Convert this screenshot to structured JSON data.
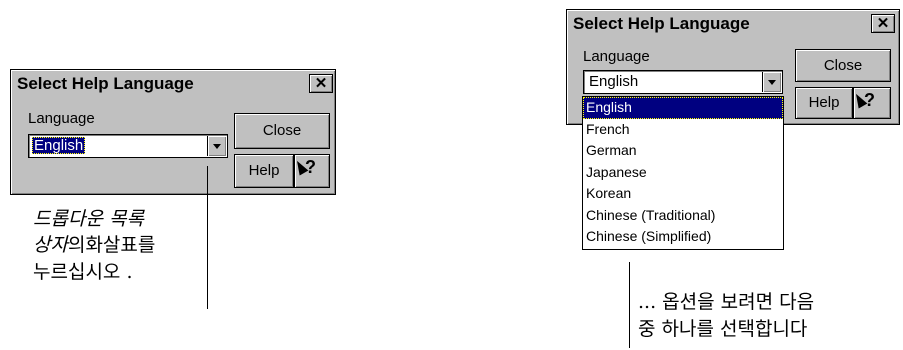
{
  "dialog_left": {
    "title": "Select Help Language",
    "close_x": "✕",
    "language_label": "Language",
    "combo_value": "English",
    "close_button": "Close",
    "help_button": "Help",
    "whats_this_button": "?"
  },
  "dialog_right": {
    "title": "Select Help Language",
    "close_x": "✕",
    "language_label": "Language",
    "combo_value": "English",
    "close_button": "Close",
    "help_button": "Help",
    "whats_this_button": "?",
    "options": [
      "English",
      "French",
      "German",
      "Japanese",
      "Korean",
      "Chinese (Traditional)",
      "Chinese (Simplified)"
    ],
    "selected_option": "English"
  },
  "callouts": {
    "left_line1": "드롭다운 목록",
    "left_line2_italic": "상자",
    "left_line2_rest": "의화살표를",
    "left_line3": "누르십시오 .",
    "right_line1": "... 옵션을 보려면 다음",
    "right_line2": "중 하나를 선택합니다"
  },
  "colors": {
    "dialog_face": "#c0c0c0",
    "selection": "#000080",
    "background": "#ffffff"
  }
}
